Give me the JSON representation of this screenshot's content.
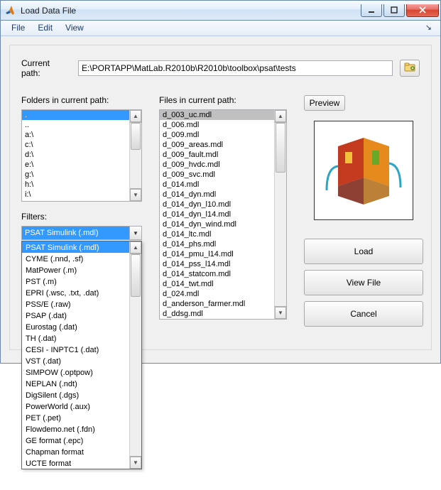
{
  "window": {
    "title": "Load Data File"
  },
  "menus": {
    "file": "File",
    "edit": "Edit",
    "view": "View",
    "dock": "↘"
  },
  "path": {
    "label": "Current path:",
    "value": "E:\\PORTAPP\\MatLab.R2010b\\R2010b\\toolbox\\psat\\tests"
  },
  "folders": {
    "label": "Folders in current path:",
    "items": [
      ".",
      "..",
      "a:\\",
      "c:\\",
      "d:\\",
      "e:\\",
      "g:\\",
      "h:\\",
      "i:\\"
    ],
    "selected_index": 0
  },
  "files": {
    "label": "Files in current path:",
    "items": [
      "d_003_uc.mdl",
      "d_006.mdl",
      "d_009.mdl",
      "d_009_areas.mdl",
      "d_009_fault.mdl",
      "d_009_hvdc.mdl",
      "d_009_svc.mdl",
      "d_014.mdl",
      "d_014_dyn.mdl",
      "d_014_dyn_l10.mdl",
      "d_014_dyn_l14.mdl",
      "d_014_dyn_wind.mdl",
      "d_014_ltc.mdl",
      "d_014_phs.mdl",
      "d_014_pmu_l14.mdl",
      "d_014_pss_l14.mdl",
      "d_014_statcom.mdl",
      "d_014_twt.mdl",
      "d_024.mdl",
      "d_anderson_farmer.mdl",
      "d_ddsg.mdl"
    ],
    "selected_index": 0
  },
  "filters": {
    "label": "Filters:",
    "selected": "PSAT Simulink (.mdl)",
    "options": [
      "PSAT Simulink (.mdl)",
      "CYME (.nnd, .sf)",
      "MatPower (.m)",
      "PST (.m)",
      "EPRI (.wsc, .txt, .dat)",
      "PSS/E (.raw)",
      "PSAP (.dat)",
      "Eurostag (.dat)",
      "TH (.dat)",
      "CESI - INPTC1 (.dat)",
      "VST (.dat)",
      "SIMPOW (.optpow)",
      "NEPLAN (.ndt)",
      "DigSilent (.dgs)",
      "PowerWorld (.aux)",
      "PET (.pet)",
      "Flowdemo.net (.fdn)",
      "GE format (.epc)",
      "Chapman format",
      "UCTE format"
    ],
    "selected_index": 0
  },
  "buttons": {
    "preview": "Preview",
    "load": "Load",
    "view_file": "View File",
    "cancel": "Cancel"
  }
}
